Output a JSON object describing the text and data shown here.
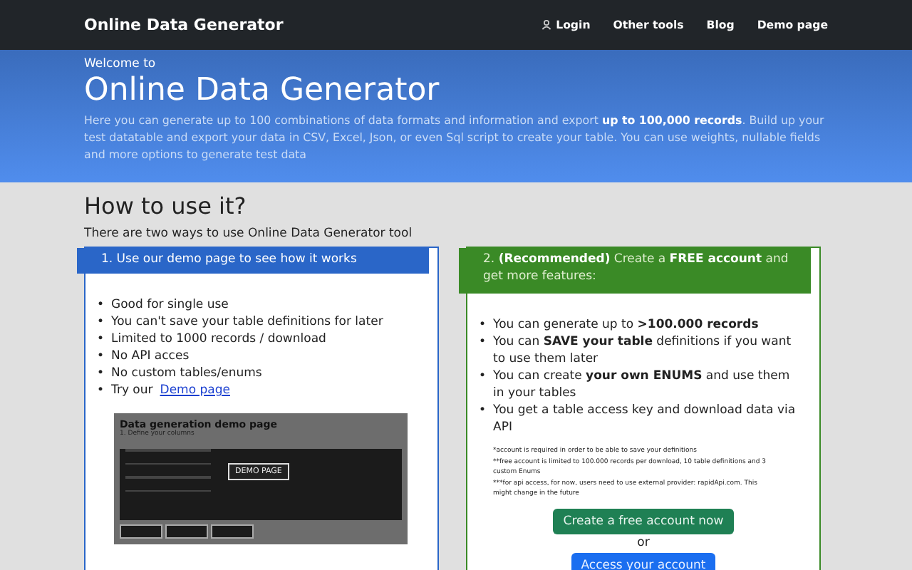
{
  "navbar": {
    "brand": "Online Data Generator",
    "links": [
      {
        "label": "Login"
      },
      {
        "label": "Other tools"
      },
      {
        "label": "Blog"
      },
      {
        "label": "Demo page"
      }
    ]
  },
  "hero": {
    "kicker": "Welcome to",
    "title": "Online Data Generator",
    "text": "Here you can generate up to 100 combinations of data formats and information and export **up to 100,000 records**. Build up your test datatable and export your data in CSV, Excel, Json, or even Sql script to create your table. You can use weights, nullable fields and more options to generate test data"
  },
  "section": {
    "title": "How to use it?",
    "intro": "There are two ways to use Online Data Generator tool"
  },
  "options": [
    {
      "kind": "demo",
      "bullet": "•",
      "header": "1. Use our demo page to see how it works",
      "items": [
        "Good for single use",
        "You can't save your table definitions for later",
        "Limited to 1000 records / download",
        "No API acces",
        "No custom tables/enums"
      ],
      "link_prefix": "Try our",
      "link": "Demo page",
      "preview": {
        "title": "Data generation demo page",
        "subtitle": "1. Define your columns",
        "button": "DEMO PAGE"
      }
    },
    {
      "kind": "account",
      "bullet": "•",
      "header": "2. **(Recommended)** Create a **FREE account** and get more features:",
      "items": [
        "You can generate up to **>100.000 records**",
        "You can **SAVE your table** definitions if you want to use them later",
        "You can create **your own ENUMS** and use them in your tables",
        "You get a table access key and download data via API"
      ],
      "notes": [
        "*account is required in order to be able to save your definitions",
        "**free account is limited to 100.000 records per download, 10 table definitions and 3 custom Enums",
        "***for api access, for now, users need to use external provider: rapidApi.com. This might change in the future"
      ],
      "primary": "Create a free account now",
      "or": "or",
      "secondary": "Access your account"
    }
  ]
}
